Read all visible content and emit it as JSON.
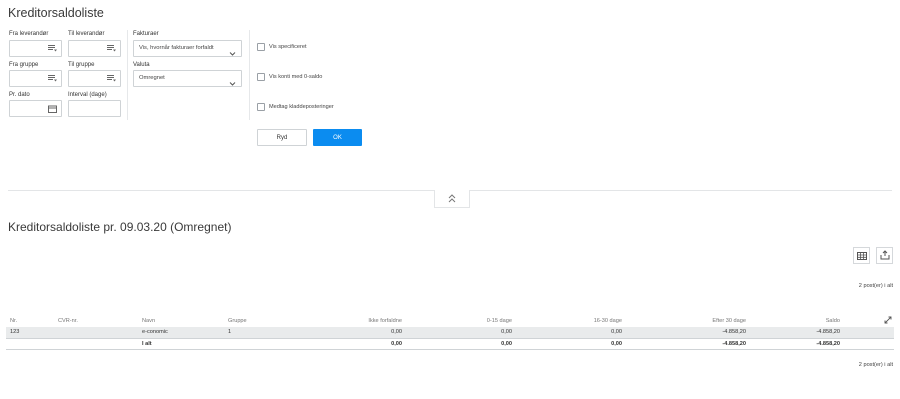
{
  "page": {
    "title": "Kreditorsaldoliste"
  },
  "filters": {
    "from_supplier": {
      "label": "Fra leverandør",
      "value": ""
    },
    "to_supplier": {
      "label": "Til leverandør",
      "value": ""
    },
    "from_group": {
      "label": "Fra gruppe",
      "value": ""
    },
    "to_group": {
      "label": "Til gruppe",
      "value": ""
    },
    "per_date": {
      "label": "Pr. dato",
      "value": ""
    },
    "interval": {
      "label": "Interval (dage)",
      "value": ""
    },
    "invoices": {
      "label": "Fakturaer",
      "selected": "Vis, hvornår fakturaer forfaldt"
    },
    "currency": {
      "label": "Valuta",
      "selected": "Omregnet"
    }
  },
  "options": {
    "show_specified": {
      "label": "Vis specificeret",
      "checked": false
    },
    "show_zero_balance": {
      "label": "Vis konti med 0-saldo",
      "checked": false
    },
    "include_drafts": {
      "label": "Medtag kladdeposteringer",
      "checked": false
    }
  },
  "buttons": {
    "clear": "Ryd",
    "ok": "OK"
  },
  "report": {
    "title": "Kreditorsaldoliste pr. 09.03.20 (Omregnet)",
    "count_top": "2 post(er) i alt",
    "count_bottom": "2 post(er) i alt",
    "columns": [
      "Nr.",
      "CVR-nr.",
      "Navn",
      "Gruppe",
      "Ikke forfaldne",
      "0-15 dage",
      "16-30 dage",
      "Efter 30 dage",
      "Saldo"
    ],
    "rows": [
      {
        "nr": "123",
        "cvr": "",
        "name": "e-conomic",
        "group": "1",
        "not_due": "0,00",
        "d0_15": "0,00",
        "d16_30": "0,00",
        "after30": "-4.858,20",
        "balance": "-4.858,20"
      }
    ],
    "total": {
      "label": "I alt",
      "not_due": "0,00",
      "d0_15": "0,00",
      "d16_30": "0,00",
      "after30": "-4.858,20",
      "balance": "-4.858,20"
    }
  },
  "icons": {
    "lookup": "list-lookup-icon",
    "calendar": "calendar-icon",
    "chevron": "chevron-down-icon",
    "collapse": "double-chevron-up-icon",
    "table_view": "table-view-icon",
    "export": "export-icon",
    "expand": "expand-icon"
  },
  "colors": {
    "accent": "#0b8cf0",
    "row_highlight": "#e9ebec"
  }
}
